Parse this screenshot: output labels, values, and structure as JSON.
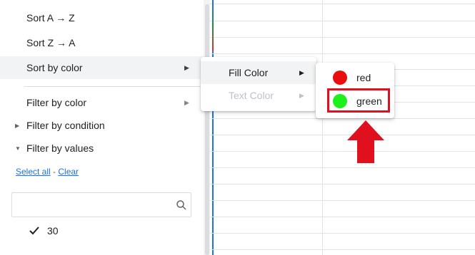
{
  "menu": {
    "sort_az": "Sort A → Z",
    "sort_za": "Sort Z → A",
    "sort_by_color": "Sort by color",
    "filter_by_color": "Filter by color",
    "filter_by_condition": "Filter by condition",
    "filter_by_values": "Filter by values",
    "select_all": "Select all",
    "separator": " - ",
    "clear": "Clear",
    "values": [
      "30"
    ]
  },
  "submenu": {
    "fill_color": "Fill Color",
    "text_color": "Text Color"
  },
  "colors": {
    "items": [
      {
        "label": "red",
        "color": "#ea0e0e"
      },
      {
        "label": "green",
        "color": "#1ef01e"
      }
    ]
  },
  "accent_colors": {
    "highlight": "#e0101e",
    "link": "#1a73e8"
  }
}
